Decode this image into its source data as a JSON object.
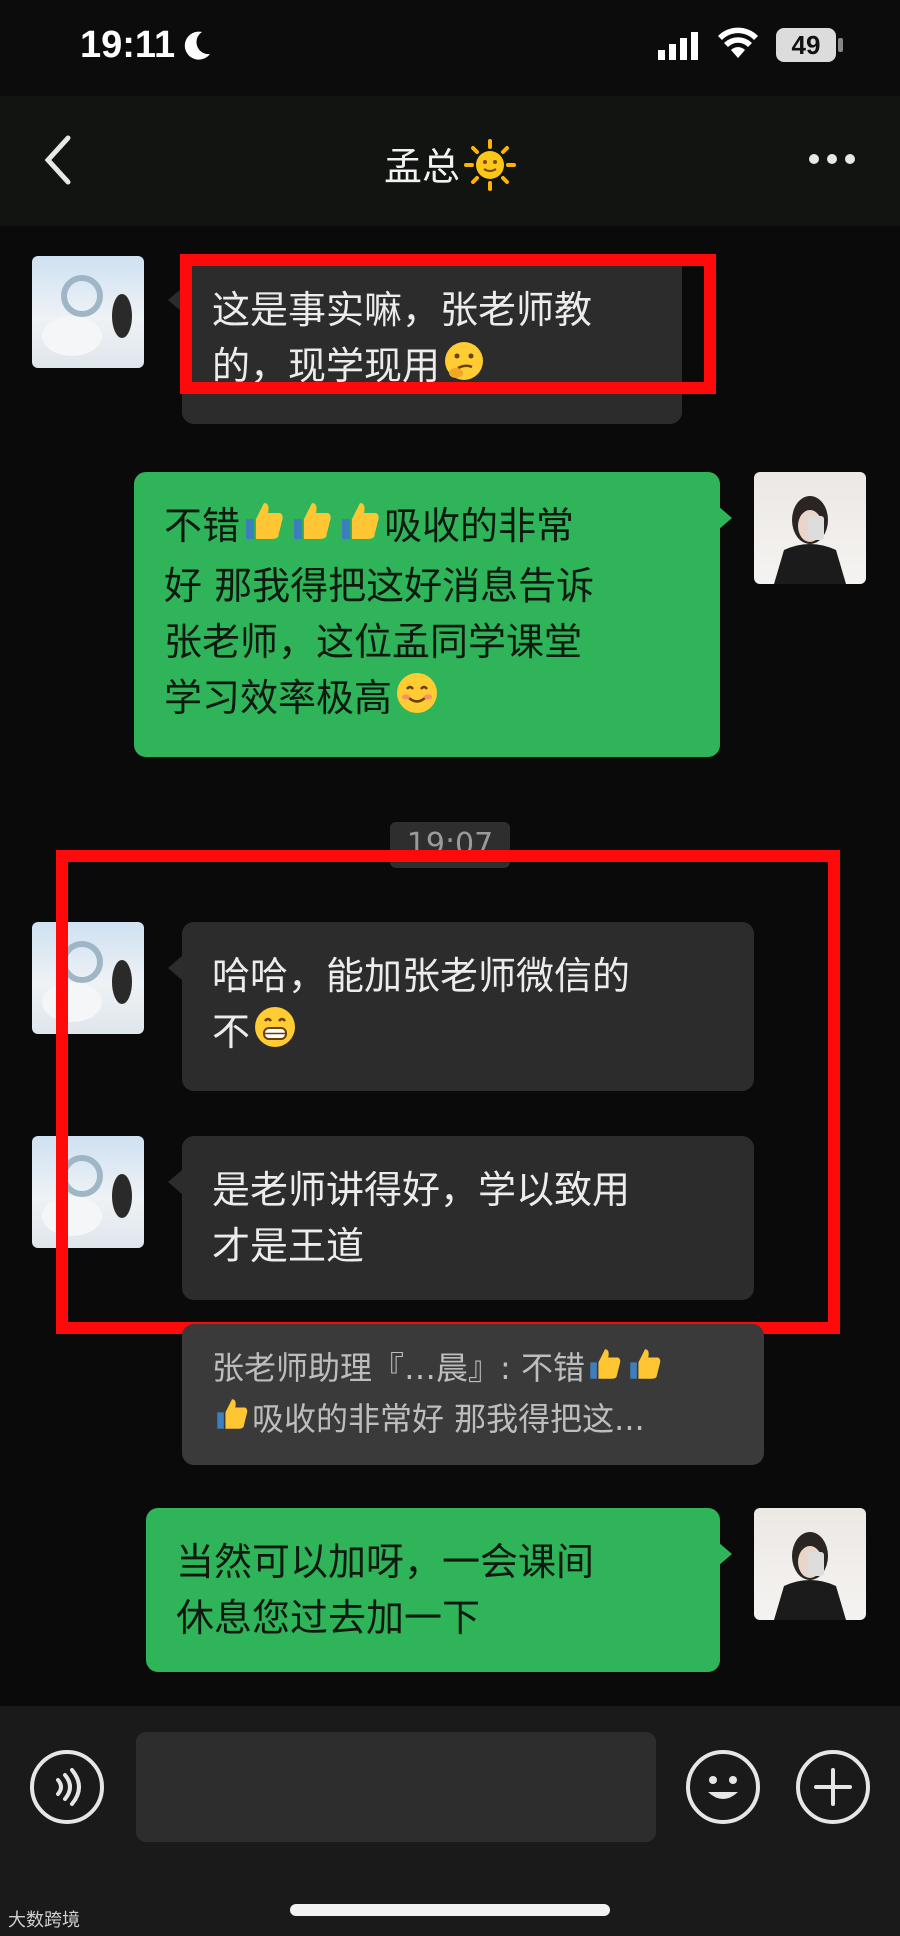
{
  "status_bar": {
    "time": "19:11",
    "battery": "49"
  },
  "nav": {
    "title": "孟总",
    "title_icon": "sun-face-emoji"
  },
  "messages": [
    {
      "side": "in",
      "text_lines": [
        "这是事实嘛，张老师教",
        "的，现学现用"
      ],
      "trailing_emoji": "thinking-face-emoji"
    },
    {
      "side": "out",
      "text_lines": [
        "不错",
        "吸收的非常",
        "好 那我得把这好消息告诉",
        "张老师，这位孟同学课堂",
        "学习效率极高"
      ],
      "emojis": [
        "thumbs-up-emoji",
        "thumbs-up-emoji",
        "thumbs-up-emoji",
        "smiling-face-emoji"
      ]
    },
    {
      "side": "in",
      "text_lines": [
        "哈哈，能加张老师微信的",
        "不"
      ],
      "trailing_emoji": "grinning-face-emoji"
    },
    {
      "side": "in",
      "text_lines": [
        "是老师讲得好，学以致用",
        "才是王道"
      ]
    },
    {
      "side": "quote",
      "text_lines": [
        "张老师助理『…晨』: 不错",
        "吸收的非常好 那我得把这..."
      ]
    },
    {
      "side": "out",
      "text_lines": [
        "当然可以加呀，一会课间",
        "休息您过去加一下"
      ]
    }
  ],
  "timestamp": "19:07",
  "highlight_color": "#ff0a0a",
  "bubble_colors": {
    "incoming": "#2c2c2c",
    "outgoing": "#2fb45a"
  },
  "input_bar": {
    "placeholder": ""
  },
  "watermark": "大数跨境"
}
